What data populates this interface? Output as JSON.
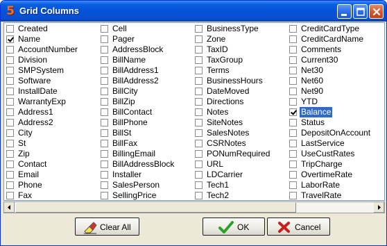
{
  "window": {
    "title": "Grid Columns",
    "app_icon_glyph": "5"
  },
  "columns": [
    [
      {
        "label": "Created",
        "checked": false
      },
      {
        "label": "Name",
        "checked": true
      },
      {
        "label": "AccountNumber",
        "checked": false
      },
      {
        "label": "Division",
        "checked": false
      },
      {
        "label": "SMPSystem",
        "checked": false
      },
      {
        "label": "Software",
        "checked": false
      },
      {
        "label": "InstallDate",
        "checked": false
      },
      {
        "label": "WarrantyExp",
        "checked": false
      },
      {
        "label": "Address1",
        "checked": false
      },
      {
        "label": "Address2",
        "checked": false
      },
      {
        "label": "City",
        "checked": false
      },
      {
        "label": "St",
        "checked": false
      },
      {
        "label": "Zip",
        "checked": false
      },
      {
        "label": "Contact",
        "checked": false
      },
      {
        "label": "Email",
        "checked": false
      },
      {
        "label": "Phone",
        "checked": false
      },
      {
        "label": "Fax",
        "checked": false
      }
    ],
    [
      {
        "label": "Cell",
        "checked": false
      },
      {
        "label": "Pager",
        "checked": false
      },
      {
        "label": "AddressBlock",
        "checked": false
      },
      {
        "label": "BillName",
        "checked": false
      },
      {
        "label": "BillAddress1",
        "checked": false
      },
      {
        "label": "BillAddress2",
        "checked": false
      },
      {
        "label": "BillCity",
        "checked": false
      },
      {
        "label": "BillZip",
        "checked": false
      },
      {
        "label": "BillContact",
        "checked": false
      },
      {
        "label": "BillPhone",
        "checked": false
      },
      {
        "label": "BillSt",
        "checked": false
      },
      {
        "label": "BillFax",
        "checked": false
      },
      {
        "label": "BillingEmail",
        "checked": false
      },
      {
        "label": "BillAddressBlock",
        "checked": false
      },
      {
        "label": "Installer",
        "checked": false
      },
      {
        "label": "SalesPerson",
        "checked": false
      },
      {
        "label": "SellingPrice",
        "checked": false
      }
    ],
    [
      {
        "label": "BusinessType",
        "checked": false
      },
      {
        "label": "Zone",
        "checked": false
      },
      {
        "label": "TaxID",
        "checked": false
      },
      {
        "label": "TaxGroup",
        "checked": false
      },
      {
        "label": "Terms",
        "checked": false
      },
      {
        "label": "BusinessHours",
        "checked": false
      },
      {
        "label": "DateMoved",
        "checked": false
      },
      {
        "label": "Directions",
        "checked": false
      },
      {
        "label": "Notes",
        "checked": false
      },
      {
        "label": "SiteNotes",
        "checked": false
      },
      {
        "label": "SalesNotes",
        "checked": false
      },
      {
        "label": "CSRNotes",
        "checked": false
      },
      {
        "label": "PONumRequired",
        "checked": false
      },
      {
        "label": "URL",
        "checked": false
      },
      {
        "label": "LDCarrier",
        "checked": false
      },
      {
        "label": "Tech1",
        "checked": false
      },
      {
        "label": "Tech2",
        "checked": false
      }
    ],
    [
      {
        "label": "CreditCardType",
        "checked": false
      },
      {
        "label": "CreditCardName",
        "checked": false
      },
      {
        "label": "Comments",
        "checked": false
      },
      {
        "label": "Current30",
        "checked": false
      },
      {
        "label": "Net30",
        "checked": false
      },
      {
        "label": "Net60",
        "checked": false
      },
      {
        "label": "Net90",
        "checked": false
      },
      {
        "label": "YTD",
        "checked": false
      },
      {
        "label": "Balance",
        "checked": true,
        "selected": true
      },
      {
        "label": "Status",
        "checked": false
      },
      {
        "label": "DepositOnAccount",
        "checked": false
      },
      {
        "label": "LastService",
        "checked": false
      },
      {
        "label": "UseCustRates",
        "checked": false
      },
      {
        "label": "TripCharge",
        "checked": false
      },
      {
        "label": "OvertimeRate",
        "checked": false
      },
      {
        "label": "LaborRate",
        "checked": false
      },
      {
        "label": "TravelRate",
        "checked": false
      }
    ]
  ],
  "buttons": {
    "clear_all": "Clear All",
    "ok": "OK",
    "cancel": "Cancel"
  },
  "colors": {
    "selection": "#316ac5",
    "titlebar": "#0453d8"
  }
}
